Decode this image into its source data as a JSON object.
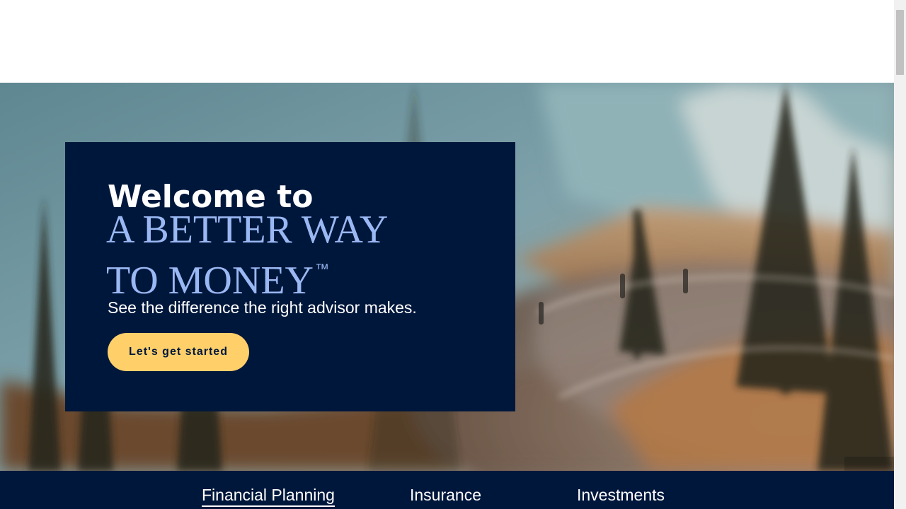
{
  "hero": {
    "welcome": "Welcome to",
    "headline_line1": "A BETTER WAY",
    "headline_line2": "TO MONEY",
    "trademark": "™",
    "subtitle": "See the difference the right advisor makes.",
    "cta_label": "Let's get started"
  },
  "product_nav": {
    "items": [
      {
        "label": "Financial Planning",
        "active": true
      },
      {
        "label": "Insurance",
        "active": false
      },
      {
        "label": "Investments",
        "active": false
      }
    ]
  },
  "colors": {
    "navy": "#00173c",
    "headline_blue": "#9ab8f3",
    "cta_yellow": "#ffd06a",
    "white": "#ffffff"
  },
  "icons": {
    "scrollbar": "vertical-scrollbar"
  }
}
